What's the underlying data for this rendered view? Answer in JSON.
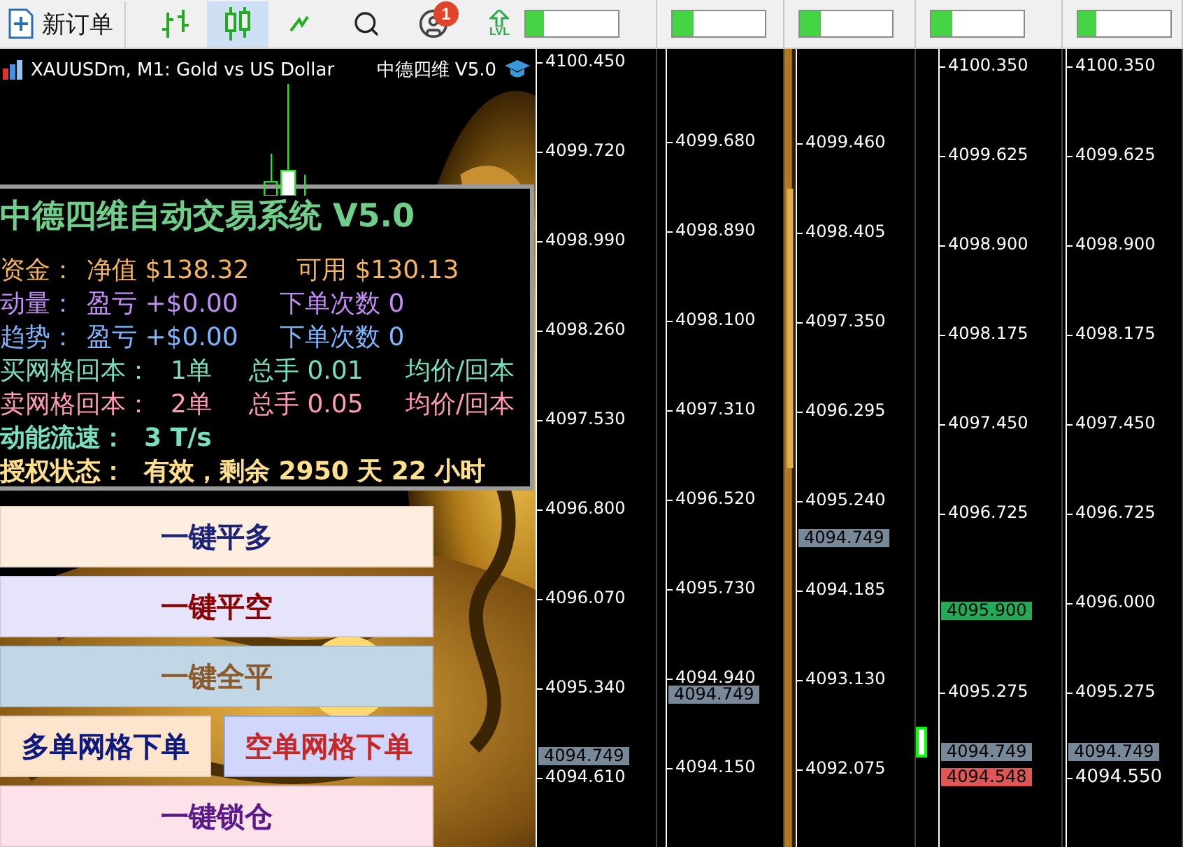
{
  "toolbar": {
    "new_order": "新订单",
    "tools": [
      {
        "kind": "bars",
        "selected": false
      },
      {
        "kind": "candles",
        "selected": true
      },
      {
        "kind": "line",
        "selected": false
      }
    ],
    "notifications": "1",
    "level_label": "LVL",
    "meters": [
      {
        "level": 0.2
      },
      {
        "level": 0.22
      },
      {
        "level": 0.22
      },
      {
        "level": 0.22
      },
      {
        "level": 0.2
      }
    ]
  },
  "panes": [
    {
      "chart": {
        "title": "XAUUSDm, M1:  Gold vs US Dollar",
        "expert": "中德四维 V5.0",
        "panel": {
          "title": "中德四维自动交易系统 V5.0",
          "lines": [
            {
              "kind": "equity",
              "cells": [
                "资金：",
                "净值 $138.32",
                "可用 $130.13"
              ]
            },
            {
              "kind": "momentum",
              "cells": [
                "动量：",
                "盈亏 +$0.00",
                "下单次数 0"
              ]
            },
            {
              "kind": "trend",
              "cells": [
                "趋势：",
                "盈亏 +$0.00",
                "下单次数 0"
              ]
            },
            {
              "kind": "buy-grid",
              "cells": [
                "买网格回本：",
                "1单",
                "总手 0.01",
                "均价/回本"
              ]
            },
            {
              "kind": "sell-grid",
              "cells": [
                "卖网格回本：",
                "2单",
                "总手 0.05",
                "均价/回本"
              ]
            },
            {
              "kind": "speed",
              "cells": [
                "动能流速：",
                "3 T/s"
              ]
            },
            {
              "kind": "license",
              "cells": [
                "授权状态：",
                "有效，剩余 2950 天 22 小时"
              ]
            }
          ]
        },
        "buttons": [
          {
            "items": [
              {
                "kind": "close-long",
                "label": "一键平多"
              }
            ]
          },
          {
            "items": [
              {
                "kind": "close-short",
                "label": "一键平空"
              }
            ]
          },
          {
            "items": [
              {
                "kind": "close-all",
                "label": "一键全平"
              }
            ]
          },
          {
            "items": [
              {
                "kind": "grid-long",
                "label": "多单网格下单"
              },
              {
                "kind": "grid-short",
                "label": "空单网格下单"
              }
            ]
          },
          {
            "items": [
              {
                "kind": "lock",
                "label": "一键锁仓"
              }
            ]
          }
        ]
      },
      "axis": {
        "ticks": [
          "4100.450",
          "4099.720",
          "4098.990",
          "4098.260",
          "4097.530",
          "4096.800",
          "4096.070",
          "4095.340",
          "4094.610"
        ],
        "tags": [
          {
            "text": "4094.749",
            "color": "#778899"
          }
        ]
      }
    },
    {
      "axis": {
        "ticks": [
          "4099.680",
          "4098.890",
          "4098.100",
          "4097.310",
          "4096.520",
          "4095.730",
          "4094.940",
          "4094.150"
        ],
        "tags": [
          {
            "text": "4094.749",
            "color": "#778899"
          }
        ]
      }
    },
    {
      "axis": {
        "ticks": [
          "4099.460",
          "4098.405",
          "4097.350",
          "4096.295",
          "4095.240",
          "4094.185",
          "4093.130",
          "4092.075"
        ],
        "tags": [
          {
            "text": "4094.749",
            "color": "#778899"
          }
        ]
      }
    },
    {
      "axis": {
        "ticks": [
          "4100.350",
          "4099.625",
          "4098.900",
          "4098.175",
          "4097.450",
          "4096.725",
          "4095.275"
        ],
        "tags": [
          {
            "text": "4095.900",
            "color": "#22aa55"
          },
          {
            "text": "4094.749",
            "color": "#778899"
          },
          {
            "text": "4094.548",
            "color": "#e05555"
          }
        ]
      }
    },
    {
      "axis": {
        "ticks": [
          "4100.350",
          "4099.625",
          "4098.900",
          "4098.175",
          "4097.450",
          "4096.725",
          "4096.000",
          "4095.275"
        ],
        "tags": [
          {
            "text": "4094.749",
            "color": "#778899"
          },
          {
            "text": "4094.550",
            "color": "#000000"
          }
        ]
      }
    }
  ]
}
